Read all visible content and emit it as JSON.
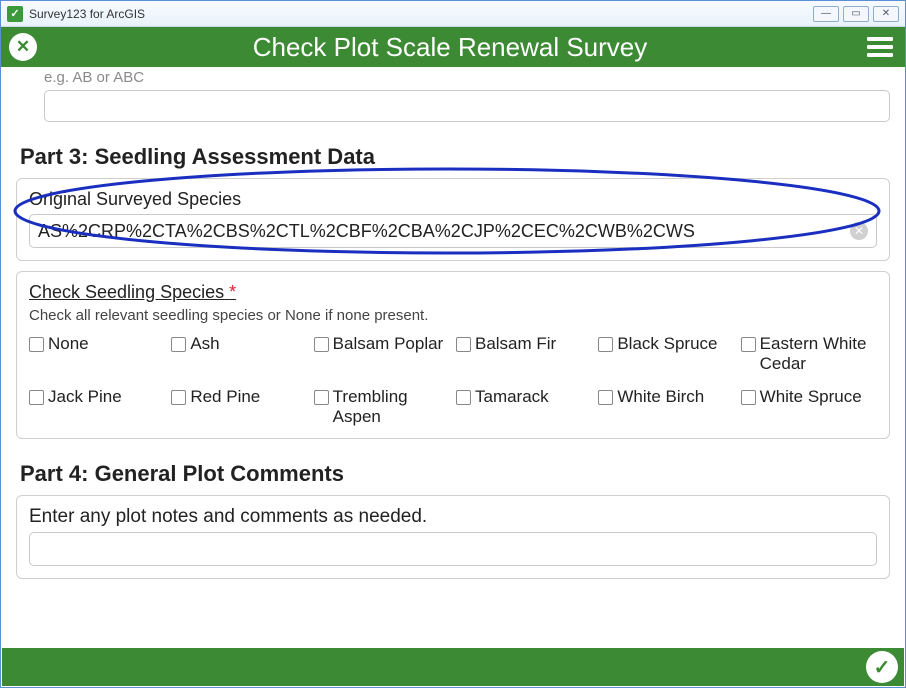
{
  "window": {
    "title": "Survey123 for ArcGIS"
  },
  "header": {
    "title": "Check Plot Scale Renewal Survey"
  },
  "prev_field": {
    "hint": "e.g. AB or ABC",
    "value": ""
  },
  "part3": {
    "heading": "Part 3: Seedling Assessment Data",
    "original_label": "Original Surveyed Species",
    "original_value": "AS%2CRP%2CTA%2CBS%2CTL%2CBF%2CBA%2CJP%2CEC%2CWB%2CWS",
    "check_label": "Check Seedling Species",
    "check_hint": "Check all relevant seedling species or None if none present.",
    "species": [
      {
        "label": "None"
      },
      {
        "label": "Ash"
      },
      {
        "label": "Balsam Poplar"
      },
      {
        "label": "Balsam Fir"
      },
      {
        "label": "Black Spruce"
      },
      {
        "label": "Eastern White Cedar"
      },
      {
        "label": "Jack Pine"
      },
      {
        "label": "Red Pine"
      },
      {
        "label": "Trembling Aspen"
      },
      {
        "label": "Tamarack"
      },
      {
        "label": "White Birch"
      },
      {
        "label": "White Spruce"
      }
    ]
  },
  "part4": {
    "heading": "Part 4: General Plot Comments",
    "notes_label": "Enter any plot notes and comments as needed.",
    "notes_value": ""
  }
}
